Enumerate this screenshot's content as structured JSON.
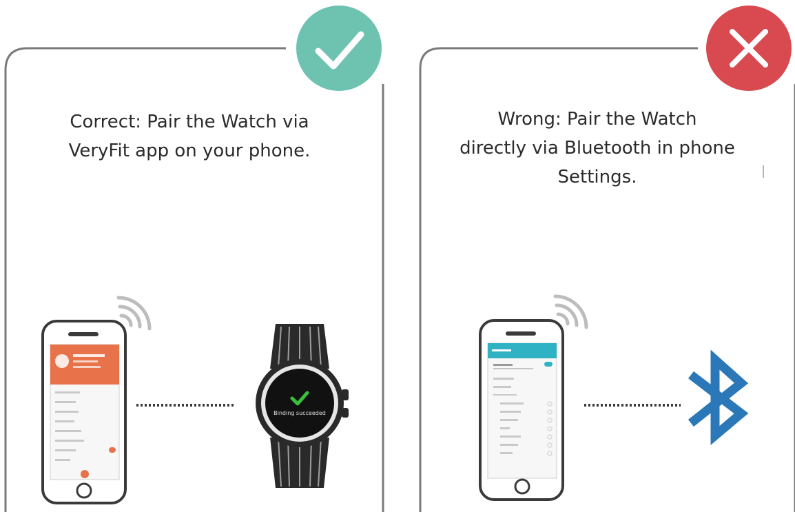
{
  "panels": {
    "correct": {
      "caption": "Correct: Pair the Watch via\nVeryFit app on your phone.",
      "badge_icon": "checkmark-icon",
      "badge_color": "#6ec3b0",
      "watch_screen_text": "Binding succeeded"
    },
    "wrong": {
      "caption": "Wrong: Pair the Watch\ndirectly via Bluetooth in phone\nSettings.",
      "badge_icon": "cross-icon",
      "badge_color": "#d94a50"
    }
  },
  "colors": {
    "frame": "#7a7a7a",
    "app_header": "#e8734a",
    "settings_header": "#2fb3c4",
    "bluetooth": "#2a78b8",
    "watch_check": "#3bbf3b"
  }
}
